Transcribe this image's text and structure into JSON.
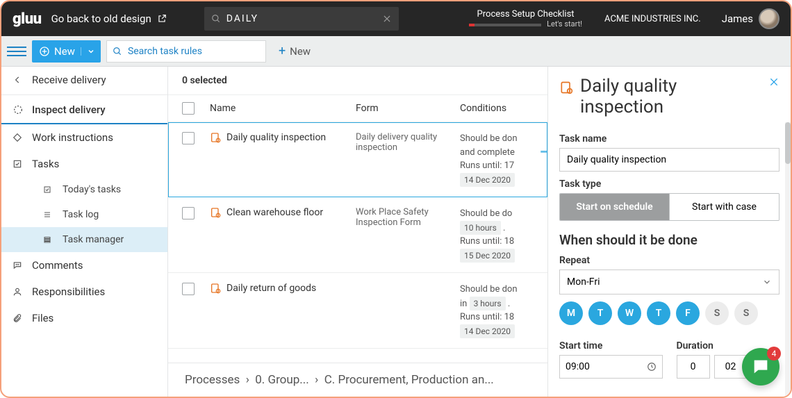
{
  "topbar": {
    "logo": "gluu",
    "go_back": "Go back to old design",
    "search_value": "DAILY",
    "checklist_title": "Process Setup Checklist",
    "checklist_cta": "Let's start!",
    "company": "ACME INDUSTRIES INC.",
    "user": "James"
  },
  "toolbar": {
    "new_label": "New",
    "search_placeholder": "Search task rules",
    "plus_new": "New"
  },
  "sidebar": {
    "back_item": "Receive delivery",
    "current": "Inspect delivery",
    "items": [
      {
        "icon": "diamond",
        "label": "Work instructions"
      },
      {
        "icon": "check-square",
        "label": "Tasks"
      }
    ],
    "task_subitems": [
      {
        "icon": "check-square",
        "label": "Today's tasks"
      },
      {
        "icon": "list",
        "label": "Task log"
      },
      {
        "icon": "grid",
        "label": "Task manager",
        "active": true
      }
    ],
    "bottom_items": [
      {
        "icon": "comment",
        "label": "Comments"
      },
      {
        "icon": "person",
        "label": "Responsibilities"
      },
      {
        "icon": "clip",
        "label": "Files"
      }
    ]
  },
  "table": {
    "selected_count": "0 selected",
    "headers": {
      "name": "Name",
      "form": "Form",
      "conditions": "Conditions"
    },
    "rows": [
      {
        "name": "Daily quality inspection",
        "form": "Daily delivery quality inspection",
        "cond_line1": "Should be don",
        "cond_line2": "and complete",
        "runs_until": "Runs until:  17",
        "date": "14 Dec 2020",
        "selected": true
      },
      {
        "name": "Clean warehouse floor",
        "form": "Work Place Safety Inspection Form",
        "cond_line1": "Should be do",
        "chip1": "10 hours",
        "runs_until": "Runs until:  18",
        "date": "15 Dec 2020"
      },
      {
        "name": "Daily return of goods",
        "form": "",
        "cond_line1": "Should be don",
        "cond_prefix": "in ",
        "chip1": "3 hours",
        "runs_until": "Runs until:  18",
        "date": "14 Dec 2020"
      }
    ]
  },
  "breadcrumb": {
    "a": "Processes",
    "b": "0. Group...",
    "c": "C. Procurement, Production an..."
  },
  "drawer": {
    "title": "Daily quality inspection",
    "task_name_label": "Task name",
    "task_name_value": "Daily quality inspection",
    "task_type_label": "Task type",
    "seg_schedule": "Start on schedule",
    "seg_case": "Start with case",
    "when_label": "When should it be done",
    "repeat_label": "Repeat",
    "repeat_value": "Mon-Fri",
    "days": [
      {
        "l": "M",
        "on": true
      },
      {
        "l": "T",
        "on": true
      },
      {
        "l": "W",
        "on": true
      },
      {
        "l": "T",
        "on": true
      },
      {
        "l": "F",
        "on": true
      },
      {
        "l": "S",
        "on": false
      },
      {
        "l": "S",
        "on": false
      }
    ],
    "start_label": "Start time",
    "start_value": "09:00",
    "duration_label": "Duration",
    "duration_h": "0",
    "duration_m": "02"
  },
  "chat_badge": "4"
}
